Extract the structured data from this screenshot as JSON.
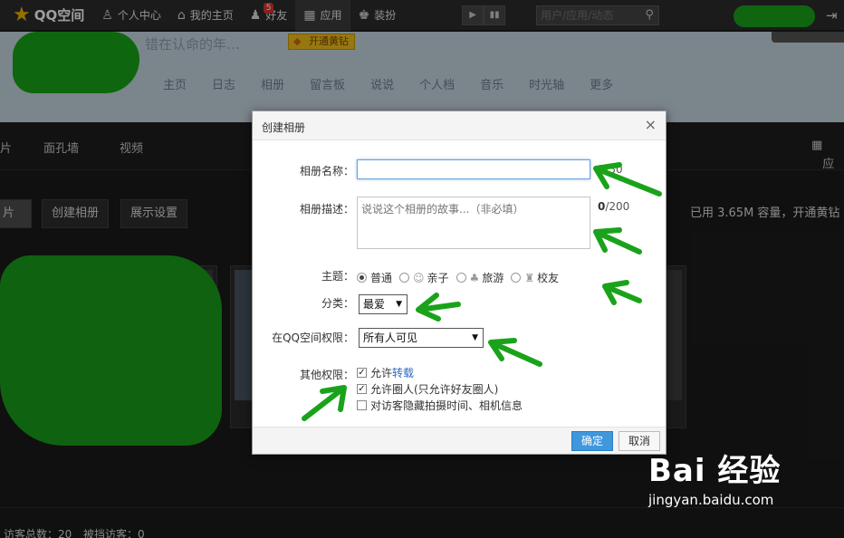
{
  "topbar": {
    "logo": "QQ空间",
    "nav": [
      {
        "label": "个人中心",
        "icon": "person-icon"
      },
      {
        "label": "我的主页",
        "icon": "home-icon"
      },
      {
        "label": "好友",
        "icon": "friends-icon",
        "badge": "5"
      },
      {
        "label": "应用",
        "icon": "apps-icon"
      },
      {
        "label": "装扮",
        "icon": "shirt-icon"
      }
    ],
    "search_placeholder": "用户/应用/动态"
  },
  "header": {
    "slogan": "错在认命的年…",
    "vip_label": "开通黄钻",
    "nav": [
      "主页",
      "日志",
      "相册",
      "留言板",
      "说说",
      "个人档",
      "音乐",
      "时光轴",
      "更多"
    ]
  },
  "album": {
    "subnav": [
      "片",
      "面孔墙",
      "视频"
    ],
    "apps_label": "应",
    "buttons": [
      "片",
      "创建相册",
      "展示设置"
    ],
    "capacity": "已用 3.65M 容量，开通黄钻"
  },
  "footer": {
    "visitors": "访客总数：20",
    "blocked": "被挡访客：0"
  },
  "dialog": {
    "title": "创建相册",
    "close": "×",
    "name_label": "相册名称：",
    "name_value": "",
    "name_counter_current": "0",
    "name_counter_max": "/30",
    "desc_label": "相册描述：",
    "desc_placeholder": "说说这个相册的故事...（非必填）",
    "desc_counter_current": "0",
    "desc_counter_max": "/200",
    "theme_label": "主题：",
    "themes": [
      {
        "label": "普通",
        "selected": true
      },
      {
        "label": "亲子",
        "selected": false
      },
      {
        "label": "旅游",
        "selected": false
      },
      {
        "label": "校友",
        "selected": false
      }
    ],
    "category_label": "分类：",
    "category_value": "最爱",
    "permission_label": "在QQ空间权限：",
    "permission_value": "所有人可见",
    "other_label": "其他权限：",
    "options": [
      {
        "prefix": "允许",
        "link": "转载",
        "suffix": "",
        "checked": true
      },
      {
        "prefix": "允许圈人(只允许好友圈人)",
        "link": "",
        "suffix": "",
        "checked": true
      },
      {
        "prefix": "对访客隐藏拍摄时间、相机信息",
        "link": "",
        "suffix": "",
        "checked": false
      }
    ],
    "ok": "确定",
    "cancel": "取消"
  },
  "watermark": {
    "logo": "Bai 经验",
    "url": "jingyan.baidu.com"
  },
  "colors": {
    "accent_blue": "#3f97dc",
    "annotation_green": "#1aa31a"
  }
}
